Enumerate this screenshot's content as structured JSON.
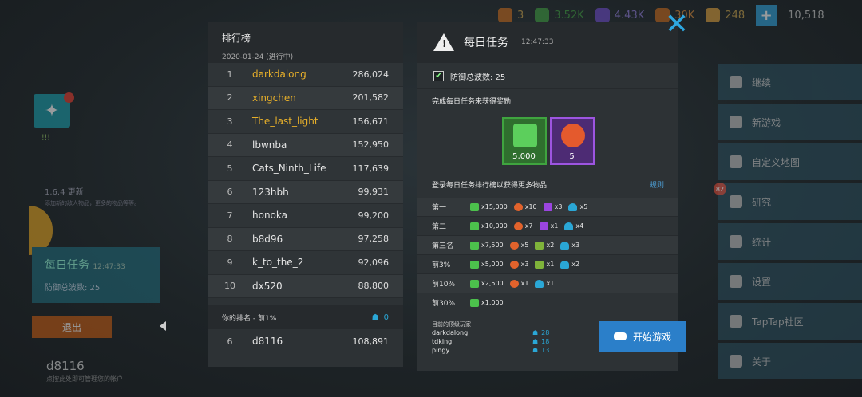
{
  "topbar": {
    "resources": [
      {
        "value": "3",
        "icon": "spiral-icon"
      },
      {
        "value": "3.52K",
        "icon": "green-cash-icon"
      },
      {
        "value": "4.43K",
        "icon": "purple-crystal-icon"
      },
      {
        "value": "30K",
        "icon": "orange-token-icon"
      },
      {
        "value": "248",
        "icon": "gold-token-icon"
      }
    ],
    "coins": "10,518"
  },
  "leaderboard": {
    "title": "排行榜",
    "date": "2020-01-24 (进行中)",
    "rows": [
      {
        "rank": "1",
        "name": "darkdalong",
        "score": "286,024"
      },
      {
        "rank": "2",
        "name": "xingchen",
        "score": "201,582"
      },
      {
        "rank": "3",
        "name": "The_last_light",
        "score": "156,671"
      },
      {
        "rank": "4",
        "name": "lbwnba",
        "score": "152,950"
      },
      {
        "rank": "5",
        "name": "Cats_Ninth_Life",
        "score": "117,639"
      },
      {
        "rank": "6",
        "name": "123hbh",
        "score": "99,931"
      },
      {
        "rank": "7",
        "name": "honoka",
        "score": "99,200"
      },
      {
        "rank": "8",
        "name": "b8d96",
        "score": "97,258"
      },
      {
        "rank": "9",
        "name": "k_to_the_2",
        "score": "92,096"
      },
      {
        "rank": "10",
        "name": "dx520",
        "score": "88,800"
      }
    ],
    "my_rank_label": "你的排名 - 前1%",
    "my_rank_value": "0",
    "me": {
      "rank": "6",
      "name": "d8116",
      "score": "108,891"
    }
  },
  "daily": {
    "title": "每日任务",
    "time": "12:47:33",
    "check_label": "防御总波数: 25",
    "subtitle": "完成每日任务来获得奖励",
    "rewards": [
      {
        "value": "5,000",
        "type": "green"
      },
      {
        "value": "5",
        "type": "purple"
      }
    ],
    "login_text": "登录每日任务排行榜以获得更多物品",
    "rules": "规则",
    "tiers": [
      {
        "label": "第一",
        "items": [
          [
            "g",
            "x15,000"
          ],
          [
            "o",
            "x10"
          ],
          [
            "p",
            "x3"
          ],
          [
            "c",
            "x5"
          ]
        ]
      },
      {
        "label": "第二",
        "items": [
          [
            "g",
            "x10,000"
          ],
          [
            "o",
            "x7"
          ],
          [
            "p",
            "x1"
          ],
          [
            "c",
            "x4"
          ]
        ]
      },
      {
        "label": "第三名",
        "items": [
          [
            "g",
            "x7,500"
          ],
          [
            "o",
            "x5"
          ],
          [
            "gr",
            "x2"
          ],
          [
            "c",
            "x3"
          ]
        ]
      },
      {
        "label": "前3%",
        "items": [
          [
            "g",
            "x5,000"
          ],
          [
            "o",
            "x3"
          ],
          [
            "gr",
            "x1"
          ],
          [
            "c",
            "x2"
          ]
        ]
      },
      {
        "label": "前10%",
        "items": [
          [
            "g",
            "x2,500"
          ],
          [
            "o",
            "x1"
          ],
          [
            "c",
            "x1"
          ]
        ]
      },
      {
        "label": "前30%",
        "items": [
          [
            "g",
            "x1,000"
          ]
        ]
      }
    ],
    "top_players_label": "目前的顶级玩家",
    "top_players": [
      {
        "name": "darkdalong",
        "value": "28"
      },
      {
        "name": "tdking",
        "value": "18"
      },
      {
        "name": "pingy",
        "value": "13"
      }
    ],
    "start_button": "开始游戏"
  },
  "left": {
    "status": "!!!",
    "version": "1.6.4 更新",
    "version_desc": "添加新的敌人物品，更多的物品等等。",
    "daily_title": "每日任务",
    "daily_time": "12:47:33",
    "daily_sub": "防御总波数: 25",
    "exit": "退出",
    "user": "d8116",
    "user_hint": "点按此处即可管理您的帐户"
  },
  "menu": {
    "items": [
      "继续",
      "新游戏",
      "自定义地图",
      "研究",
      "统计",
      "设置",
      "TapTap社区",
      "关于"
    ],
    "badge": "82"
  }
}
